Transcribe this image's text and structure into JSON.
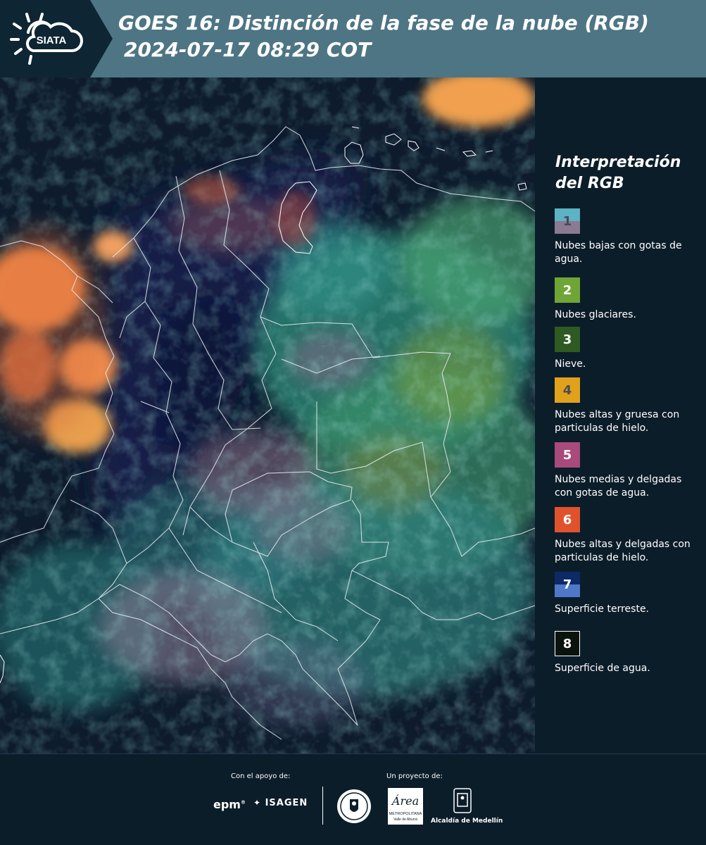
{
  "header": {
    "logo_text": "SIATA",
    "title_line1": "GOES 16: Distinción de la fase de la nube (RGB)",
    "title_line2": "2024-07-17 08:29 COT"
  },
  "legend": {
    "title_line1": "Interpretación",
    "title_line2": "del RGB",
    "items": [
      {
        "number": "1",
        "text": "Nubes bajas con gotas de agua.",
        "colors": [
          "#5bb3c4",
          "#8a7a92"
        ],
        "number_color": "#4a4a55"
      },
      {
        "number": "2",
        "text": "Nubes glaciares.",
        "colors": [
          "#6fa536"
        ],
        "number_color": "#ffffff"
      },
      {
        "number": "3",
        "text": "Nieve.",
        "colors": [
          "#2f5a22"
        ],
        "number_color": "#ffffff"
      },
      {
        "number": "4",
        "text": "Nubes altas y gruesa con particulas de hielo.",
        "colors": [
          "#e0a21c"
        ],
        "number_color": "#4a4a55"
      },
      {
        "number": "5",
        "text": "Nubes medias y delgadas con gotas de agua.",
        "colors": [
          "#a84a7c"
        ],
        "number_color": "#ffffff"
      },
      {
        "number": "6",
        "text": "Nubes altas y delgadas con particulas de hielo.",
        "colors": [
          "#e0522c"
        ],
        "number_color": "#ffffff"
      },
      {
        "number": "7",
        "text": "Superficie terreste.",
        "colors": [
          "#0d2a66",
          "#4f78c8"
        ],
        "number_color": "#ffffff"
      },
      {
        "number": "8",
        "text": "Superficie de agua.",
        "colors": [
          "#0a140d"
        ],
        "number_color": "#ffffff"
      }
    ]
  },
  "footer": {
    "support_label": "Con el apoyo de:",
    "project_label": "Un proyecto de:",
    "sponsor1": "epm",
    "sponsor2": "ISAGEN",
    "partner1_line1": "Área",
    "partner1_line2": "METROPOLITANA",
    "partner1_line3": "Valle de Aburrá",
    "partner2": "Alcaldía de Medellín"
  },
  "colors": {
    "header_bg": "#4e7584",
    "panel_bg": "#0c1d2a"
  }
}
